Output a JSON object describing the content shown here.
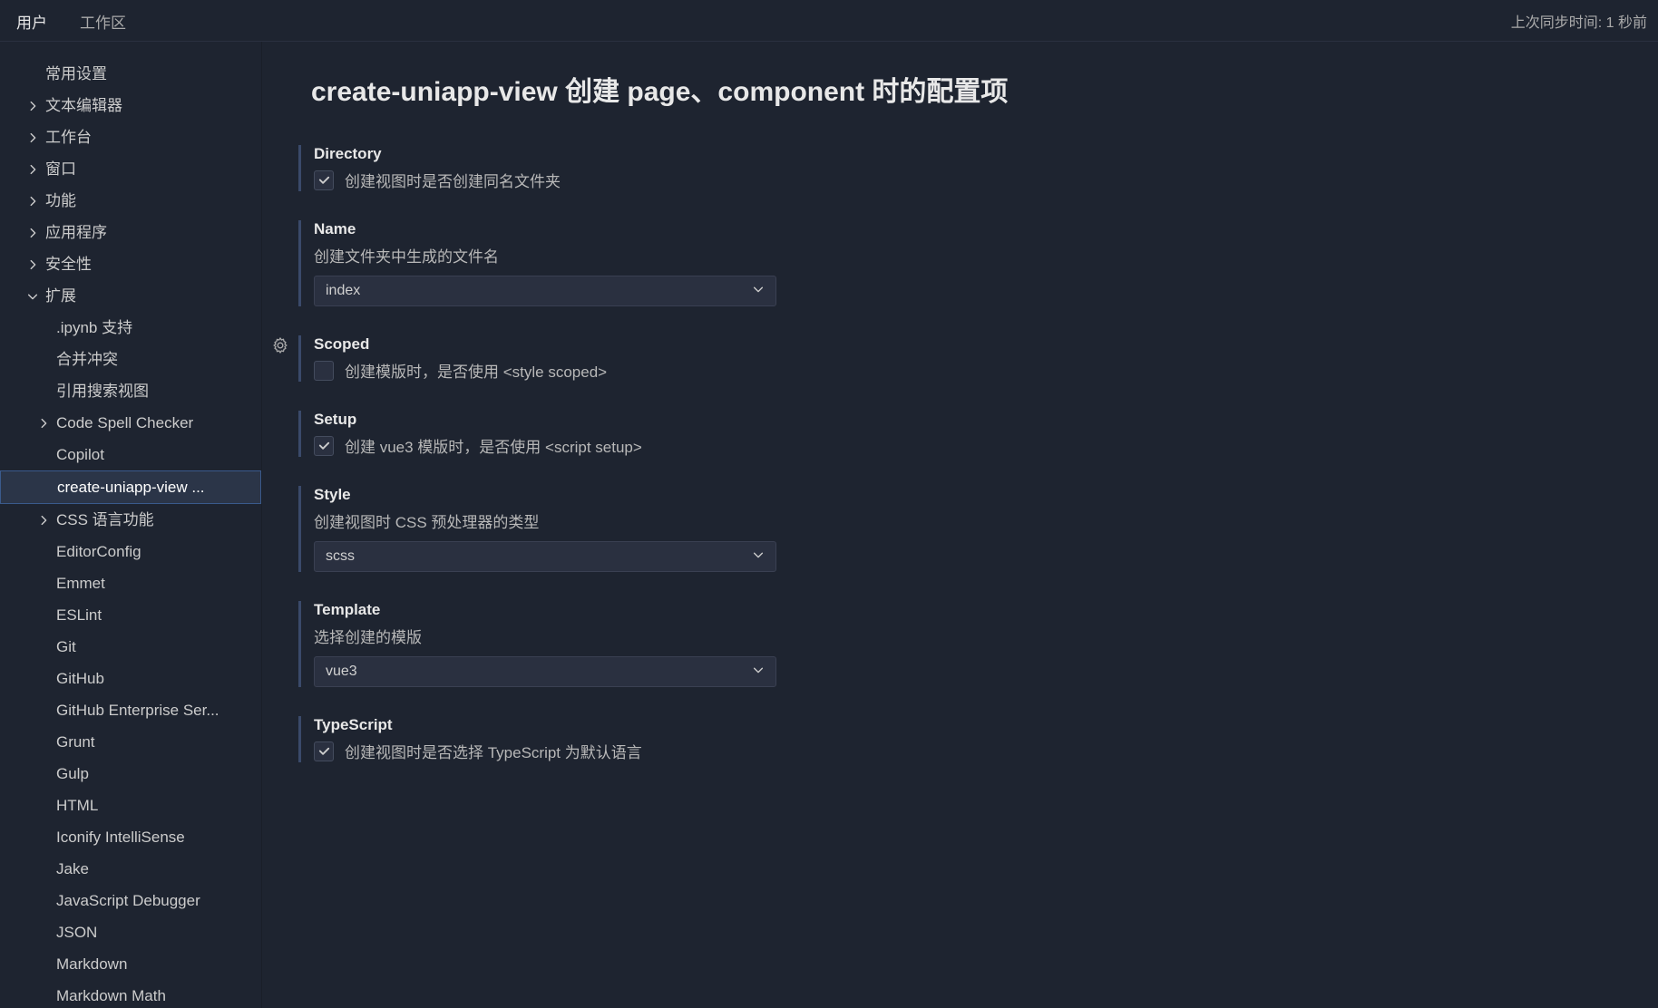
{
  "header": {
    "tabs": [
      {
        "label": "用户",
        "active": true
      },
      {
        "label": "工作区",
        "active": false
      }
    ],
    "sync_status": "上次同步时间: 1 秒前"
  },
  "sidebar": {
    "items": [
      {
        "label": "常用设置",
        "indent": 0,
        "chevron": null
      },
      {
        "label": "文本编辑器",
        "indent": 0,
        "chevron": "right"
      },
      {
        "label": "工作台",
        "indent": 0,
        "chevron": "right"
      },
      {
        "label": "窗口",
        "indent": 0,
        "chevron": "right"
      },
      {
        "label": "功能",
        "indent": 0,
        "chevron": "right"
      },
      {
        "label": "应用程序",
        "indent": 0,
        "chevron": "right"
      },
      {
        "label": "安全性",
        "indent": 0,
        "chevron": "right"
      },
      {
        "label": "扩展",
        "indent": 0,
        "chevron": "down"
      },
      {
        "label": ".ipynb 支持",
        "indent": 1,
        "chevron": null
      },
      {
        "label": "合并冲突",
        "indent": 1,
        "chevron": null
      },
      {
        "label": "引用搜索视图",
        "indent": 1,
        "chevron": null
      },
      {
        "label": "Code Spell Checker",
        "indent": 1,
        "chevron": "right"
      },
      {
        "label": "Copilot",
        "indent": 1,
        "chevron": null
      },
      {
        "label": "create-uniapp-view ...",
        "indent": 1,
        "chevron": null,
        "selected": true
      },
      {
        "label": "CSS 语言功能",
        "indent": 1,
        "chevron": "right"
      },
      {
        "label": "EditorConfig",
        "indent": 1,
        "chevron": null
      },
      {
        "label": "Emmet",
        "indent": 1,
        "chevron": null
      },
      {
        "label": "ESLint",
        "indent": 1,
        "chevron": null
      },
      {
        "label": "Git",
        "indent": 1,
        "chevron": null
      },
      {
        "label": "GitHub",
        "indent": 1,
        "chevron": null
      },
      {
        "label": "GitHub Enterprise Ser...",
        "indent": 1,
        "chevron": null
      },
      {
        "label": "Grunt",
        "indent": 1,
        "chevron": null
      },
      {
        "label": "Gulp",
        "indent": 1,
        "chevron": null
      },
      {
        "label": "HTML",
        "indent": 1,
        "chevron": null
      },
      {
        "label": "Iconify IntelliSense",
        "indent": 1,
        "chevron": null
      },
      {
        "label": "Jake",
        "indent": 1,
        "chevron": null
      },
      {
        "label": "JavaScript Debugger",
        "indent": 1,
        "chevron": null
      },
      {
        "label": "JSON",
        "indent": 1,
        "chevron": null
      },
      {
        "label": "Markdown",
        "indent": 1,
        "chevron": null
      },
      {
        "label": "Markdown Math",
        "indent": 1,
        "chevron": null
      }
    ]
  },
  "content": {
    "title": "create-uniapp-view 创建 page、component 时的配置项",
    "settings": [
      {
        "key": "directory",
        "title": "Directory",
        "type": "checkbox",
        "checked": true,
        "desc": "创建视图时是否创建同名文件夹",
        "gear": false
      },
      {
        "key": "name",
        "title": "Name",
        "type": "select",
        "desc": "创建文件夹中生成的文件名",
        "value": "index",
        "gear": false
      },
      {
        "key": "scoped",
        "title": "Scoped",
        "type": "checkbox",
        "checked": false,
        "desc": "创建模版时，是否使用 <style scoped>",
        "gear": true
      },
      {
        "key": "setup",
        "title": "Setup",
        "type": "checkbox",
        "checked": true,
        "desc": "创建 vue3 模版时，是否使用 <script setup>",
        "gear": false
      },
      {
        "key": "style",
        "title": "Style",
        "type": "select",
        "desc": "创建视图时 CSS 预处理器的类型",
        "value": "scss",
        "gear": false
      },
      {
        "key": "template",
        "title": "Template",
        "type": "select",
        "desc": "选择创建的模版",
        "value": "vue3",
        "gear": false
      },
      {
        "key": "typescript",
        "title": "TypeScript",
        "type": "checkbox",
        "checked": true,
        "desc": "创建视图时是否选择 TypeScript 为默认语言",
        "gear": false
      }
    ]
  }
}
